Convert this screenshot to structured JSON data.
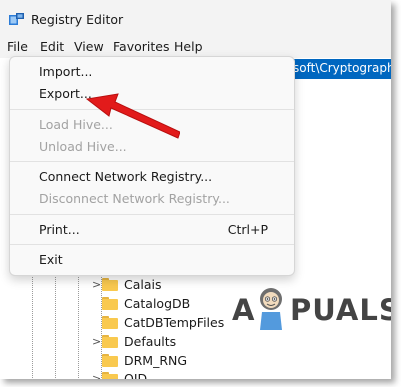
{
  "window": {
    "title": "Registry Editor"
  },
  "menubar": {
    "items": [
      {
        "label": "File"
      },
      {
        "label": "Edit"
      },
      {
        "label": "View"
      },
      {
        "label": "Favorites"
      },
      {
        "label": "Help"
      }
    ]
  },
  "address_bar": {
    "value": "soft\\Cryptography"
  },
  "file_menu": {
    "items": [
      {
        "label": "Import...",
        "shortcut": "",
        "enabled": true
      },
      {
        "label": "Export...",
        "shortcut": "",
        "enabled": true
      },
      {
        "label": "Load Hive...",
        "shortcut": "",
        "enabled": false
      },
      {
        "label": "Unload Hive...",
        "shortcut": "",
        "enabled": false
      },
      {
        "label": "Connect Network Registry...",
        "shortcut": "",
        "enabled": true
      },
      {
        "label": "Disconnect Network Registry...",
        "shortcut": "",
        "enabled": false
      },
      {
        "label": "Print...",
        "shortcut": "Ctrl+P",
        "enabled": true
      },
      {
        "label": "Exit",
        "shortcut": "",
        "enabled": true
      }
    ]
  },
  "tree": {
    "nodes": [
      {
        "label": "Calais",
        "expandable": true
      },
      {
        "label": "CatalogDB",
        "expandable": false
      },
      {
        "label": "CatDBTempFiles",
        "expandable": false
      },
      {
        "label": "Defaults",
        "expandable": true
      },
      {
        "label": "DRM_RNG",
        "expandable": false
      },
      {
        "label": "OID",
        "expandable": true
      }
    ]
  },
  "watermark": {
    "text_left": "A",
    "text_right": "PUALS"
  },
  "colors": {
    "selection": "#0067c0",
    "annotation_arrow": "#e21b1b",
    "folder": "#f9c94f"
  }
}
